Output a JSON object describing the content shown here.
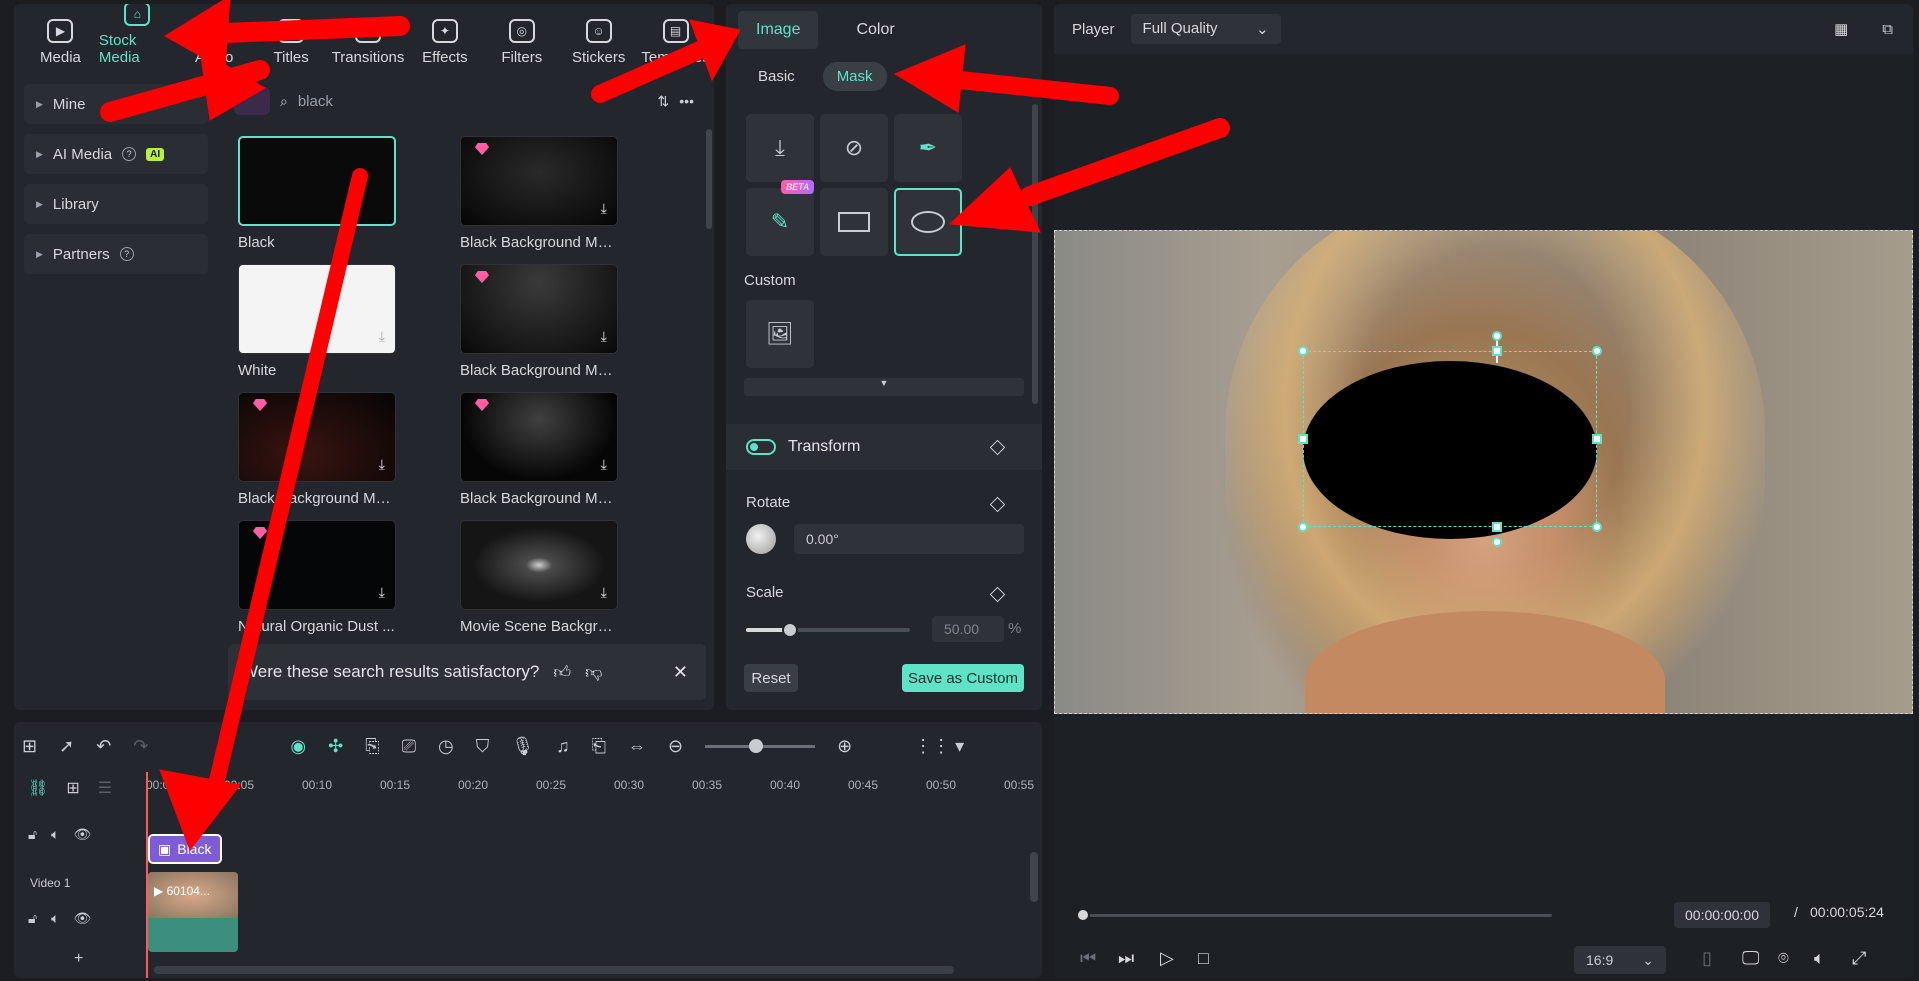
{
  "toolbar": {
    "items": [
      {
        "label": "Media"
      },
      {
        "label": "Stock Media"
      },
      {
        "label": "Audio"
      },
      {
        "label": "Titles"
      },
      {
        "label": "Transitions"
      },
      {
        "label": "Effects"
      },
      {
        "label": "Filters"
      },
      {
        "label": "Stickers"
      },
      {
        "label": "Templates"
      }
    ]
  },
  "sidebar": {
    "items": [
      {
        "label": "Mine"
      },
      {
        "label": "AI Media",
        "badge": "AI"
      },
      {
        "label": "Library"
      },
      {
        "label": "Partners"
      }
    ]
  },
  "search": {
    "placeholder": "black"
  },
  "results": [
    {
      "label": "Black"
    },
    {
      "label": "Black Background Me..."
    },
    {
      "label": "White"
    },
    {
      "label": "Black Background Me..."
    },
    {
      "label": "Black Background Me..."
    },
    {
      "label": "Black Background Me..."
    },
    {
      "label": "Natural Organic Dust ..."
    },
    {
      "label": "Movie Scene Backgro..."
    }
  ],
  "feedback": {
    "text": "Were these search results satisfactory?"
  },
  "props": {
    "tabs": [
      "Image",
      "Color"
    ],
    "subtabs": [
      "Basic",
      "Mask"
    ],
    "beta": "BETA",
    "custom_label": "Custom",
    "transform_label": "Transform",
    "rotate_label": "Rotate",
    "rotate_value": "0.00°",
    "scale_label": "Scale",
    "scale_value": "50.00",
    "scale_unit": "%",
    "reset": "Reset",
    "save": "Save as Custom"
  },
  "player": {
    "label": "Player",
    "quality": "Full Quality",
    "current_time": "00:00:00:00",
    "separator": "/",
    "total_time": "00:00:05:24",
    "ratio": "16:9"
  },
  "timeline": {
    "ticks": [
      "00:00",
      "00:05",
      "00:10",
      "00:15",
      "00:20",
      "00:25",
      "00:30",
      "00:35",
      "00:40",
      "00:45",
      "00:50",
      "00:55"
    ],
    "track_name": "Video 1",
    "clip_black": "Black",
    "clip_video": "60104..."
  }
}
